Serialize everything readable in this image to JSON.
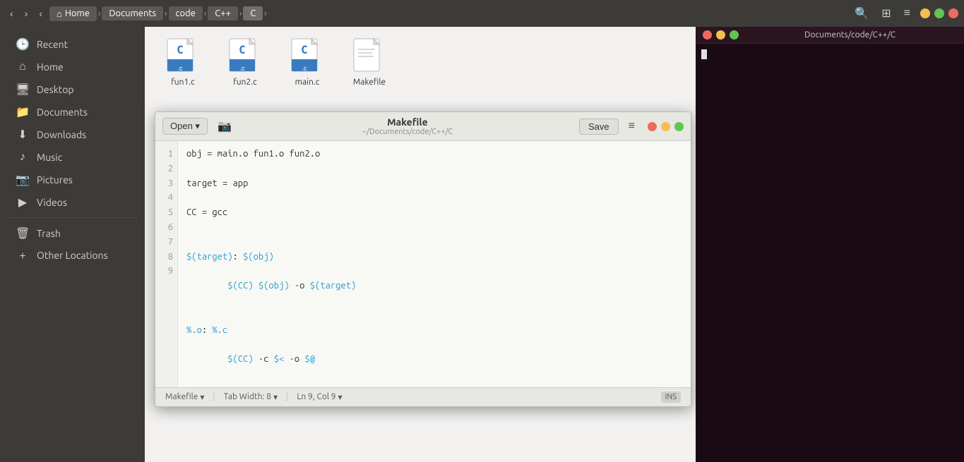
{
  "topbar": {
    "nav_back": "‹",
    "nav_forward": "›",
    "nav_up": "‹",
    "breadcrumbs": [
      {
        "id": "home",
        "label": "Home",
        "icon": "⌂"
      },
      {
        "id": "documents",
        "label": "Documents"
      },
      {
        "id": "code",
        "label": "code"
      },
      {
        "id": "cpp",
        "label": "C++"
      },
      {
        "id": "c",
        "label": "C",
        "active": true
      }
    ],
    "nav_more": "›",
    "search_icon": "🔍",
    "grid_icon": "⊞",
    "menu_icon": "≡"
  },
  "sidebar": {
    "items": [
      {
        "id": "recent",
        "icon": "🕒",
        "label": "Recent"
      },
      {
        "id": "home",
        "icon": "⌂",
        "label": "Home"
      },
      {
        "id": "desktop",
        "icon": "🖥",
        "label": "Desktop"
      },
      {
        "id": "documents",
        "icon": "📁",
        "label": "Documents"
      },
      {
        "id": "downloads",
        "icon": "⬇",
        "label": "Downloads"
      },
      {
        "id": "music",
        "icon": "♪",
        "label": "Music"
      },
      {
        "id": "pictures",
        "icon": "📷",
        "label": "Pictures"
      },
      {
        "id": "videos",
        "icon": "▶",
        "label": "Videos"
      },
      {
        "id": "trash",
        "icon": "🗑",
        "label": "Trash"
      },
      {
        "id": "other",
        "icon": "+",
        "label": "Other Locations"
      }
    ]
  },
  "files": [
    {
      "id": "fun1c",
      "name": "fun1.c",
      "type": "c"
    },
    {
      "id": "fun2c",
      "name": "fun2.c",
      "type": "c"
    },
    {
      "id": "mainc",
      "name": "main.c",
      "type": "c"
    },
    {
      "id": "makefile",
      "name": "Makefile",
      "type": "makefile"
    }
  ],
  "editor": {
    "open_label": "Open ▾",
    "save_label": "Save",
    "menu_icon": "≡",
    "toolbar_icon": "📷",
    "filename": "Makefile",
    "filepath": "~/Documents/code/C++/C",
    "window_controls": {
      "close": "×",
      "min": "−",
      "max": "□"
    },
    "lines": [
      {
        "num": 1,
        "text": "obj = main.o fun1.o fun2.o"
      },
      {
        "num": 2,
        "text": "target = app"
      },
      {
        "num": 3,
        "text": "CC = gcc"
      },
      {
        "num": 4,
        "text": ""
      },
      {
        "num": 5,
        "text": "$(target): $(obj)"
      },
      {
        "num": 6,
        "text": "        $(CC) $(obj) -o $(target)"
      },
      {
        "num": 7,
        "text": ""
      },
      {
        "num": 8,
        "text": "%.o: %.c"
      },
      {
        "num": 9,
        "text": "        $(CC) -c $< -o $@"
      }
    ],
    "statusbar": {
      "filetype": "Makefile",
      "filetype_arrow": "▾",
      "tab_width": "Tab Width: 8",
      "tab_arrow": "▾",
      "position": "Ln 9, Col 9",
      "pos_arrow": "▾",
      "insert": "INS"
    }
  },
  "terminal": {
    "title": "Documents/code/C++/C",
    "content": ""
  }
}
